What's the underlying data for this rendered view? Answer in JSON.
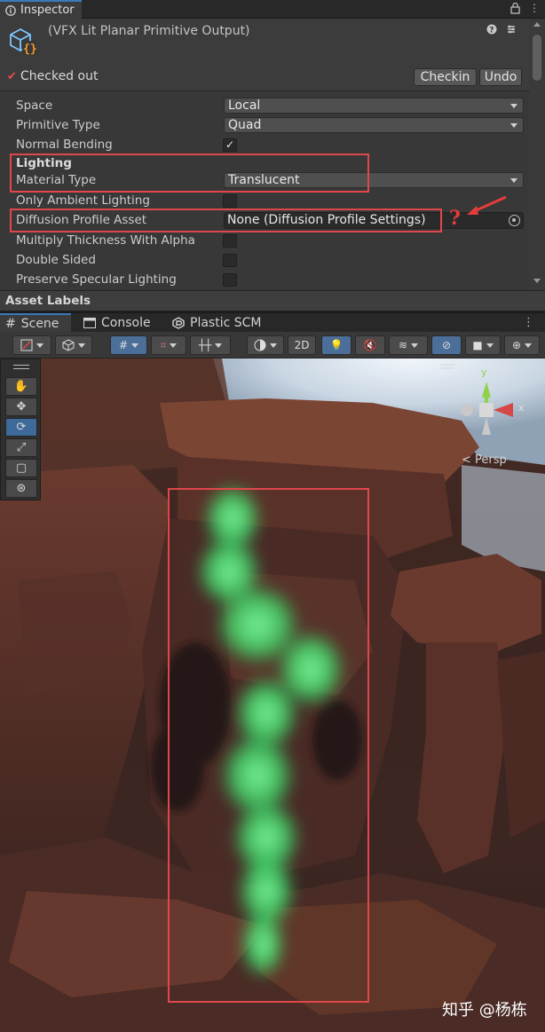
{
  "inspector": {
    "tab_label": "Inspector",
    "tab_icons": [
      "info-icon",
      "lock-icon",
      "kebab-menu-icon"
    ],
    "asset_title": "(VFX Lit Planar Primitive Output)",
    "header_icons": [
      "help-icon",
      "preset-icon",
      "kebab-menu-icon"
    ],
    "checked_out_label": "Checked out",
    "checkin_label": "Checkin",
    "undo_label": "Undo",
    "properties": [
      {
        "label": "Space",
        "type": "dropdown",
        "value": "Local"
      },
      {
        "label": "Primitive Type",
        "type": "dropdown",
        "value": "Quad"
      },
      {
        "label": "Normal Bending",
        "type": "toggle",
        "checked": true
      },
      {
        "label": "Lighting",
        "type": "header"
      },
      {
        "label": "Material Type",
        "type": "dropdown",
        "value": "Translucent"
      },
      {
        "label": "Only Ambient Lighting",
        "type": "toggle",
        "checked": false
      },
      {
        "label": "Diffusion Profile Asset",
        "type": "object",
        "value": "None (Diffusion Profile Settings)"
      },
      {
        "label": "Multiply Thickness With Alpha",
        "type": "toggle",
        "checked": false
      },
      {
        "label": "Double Sided",
        "type": "toggle",
        "checked": false
      },
      {
        "label": "Preserve Specular Lighting",
        "type": "toggle",
        "checked": false
      }
    ],
    "asset_labels_title": "Asset Labels"
  },
  "annotation": {
    "question_mark": "?",
    "color": "#e0474b"
  },
  "scene": {
    "tabs": [
      {
        "label": "Scene",
        "icon": "grid-icon",
        "active": true
      },
      {
        "label": "Console",
        "icon": "console-icon",
        "active": false
      },
      {
        "label": "Plastic SCM",
        "icon": "plastic-scm-icon",
        "active": false
      }
    ],
    "toolbar": {
      "mode_2d_label": "2D"
    },
    "tools": [
      "view-tool-hand-icon",
      "move-tool-icon",
      "rotate-tool-icon",
      "scale-tool-icon",
      "rect-tool-icon",
      "transform-tool-icon"
    ],
    "gizmo_x_label": "x",
    "gizmo_y_label": "y",
    "persp_label": "< Persp"
  },
  "watermark": "知乎 @杨栋",
  "colors": {
    "accent_blue": "#3a79bb",
    "smoke_green": "#3fdc6a",
    "rock_red": "#6b3a2f"
  }
}
